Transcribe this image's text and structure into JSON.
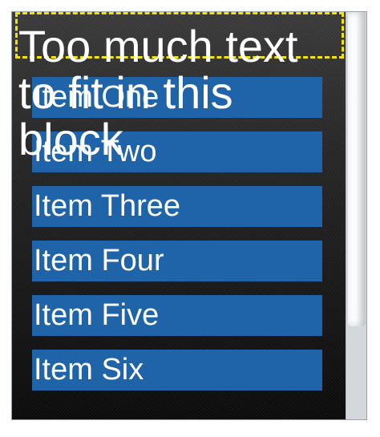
{
  "header": {
    "text": "Too much text to fit in this block"
  },
  "list": {
    "items": [
      {
        "label": "Item One"
      },
      {
        "label": "Item Two"
      },
      {
        "label": "Item Three"
      },
      {
        "label": "Item Four"
      },
      {
        "label": "Item Five"
      },
      {
        "label": "Item Six"
      }
    ]
  },
  "colors": {
    "item_background": "#1f63a8",
    "header_border": "#f2e600",
    "text": "#ffffff"
  }
}
